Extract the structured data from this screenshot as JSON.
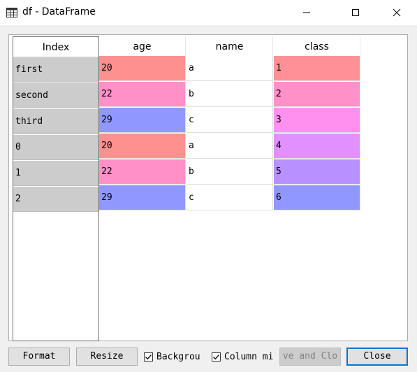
{
  "window": {
    "title": "df - DataFrame",
    "icon": "table-icon",
    "controls": [
      "minimize-icon",
      "maximize-icon",
      "close-icon"
    ]
  },
  "table": {
    "index_header": "Index",
    "columns": [
      "age",
      "name",
      "class"
    ],
    "index": [
      "first",
      "second",
      "third",
      "0",
      "1",
      "2"
    ],
    "rows": [
      [
        "20",
        "a",
        "1"
      ],
      [
        "22",
        "b",
        "2"
      ],
      [
        "29",
        "c",
        "3"
      ],
      [
        "20",
        "a",
        "4"
      ],
      [
        "22",
        "b",
        "5"
      ],
      [
        "29",
        "c",
        "6"
      ]
    ],
    "background_colors": {
      "age": [
        "#ff9090",
        "#ff90c8",
        "#9098ff",
        "#ff9090",
        "#ff90c8",
        "#9098ff"
      ],
      "name": [
        "#ffffff",
        "#ffffff",
        "#ffffff",
        "#ffffff",
        "#ffffff",
        "#ffffff"
      ],
      "class": [
        "#ff9098",
        "#ff90c8",
        "#ff90f0",
        "#e090ff",
        "#b890ff",
        "#9098ff"
      ]
    },
    "index_color": "#cccccc"
  },
  "footer": {
    "format_label": "Format",
    "resize_label": "Resize",
    "background_checkbox": {
      "label": "Backgrou",
      "checked": true
    },
    "column_min_checkbox": {
      "label": "Column mi",
      "checked": true
    },
    "save_close_label": "ve and Clo",
    "close_label": "Close"
  }
}
